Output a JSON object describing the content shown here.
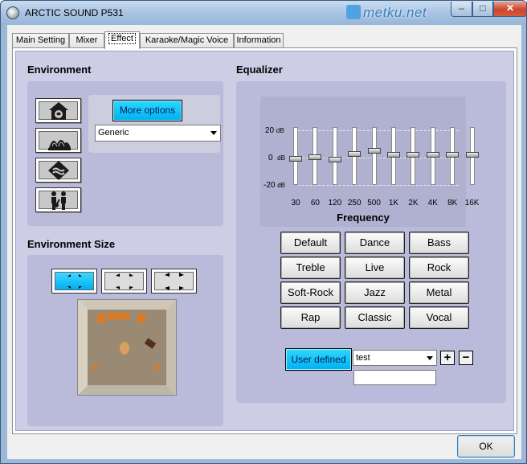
{
  "window": {
    "title": "ARCTIC SOUND P531",
    "watermark": "metku.net",
    "close_glyph": "✕",
    "min_glyph": "–",
    "max_glyph": "□"
  },
  "tabs": [
    {
      "label": "Main Setting"
    },
    {
      "label": "Mixer"
    },
    {
      "label": "Effect",
      "active": true
    },
    {
      "label": "Karaoke/Magic Voice"
    },
    {
      "label": "Information"
    }
  ],
  "environment": {
    "heading": "Environment",
    "buttons": [
      {
        "icon": "house-icon"
      },
      {
        "icon": "opera-house-icon"
      },
      {
        "icon": "water-icon"
      },
      {
        "icon": "people-icon"
      }
    ],
    "more_options_label": "More options",
    "preset": {
      "value": "Generic"
    }
  },
  "environment_size": {
    "heading": "Environment Size",
    "sizes": [
      {
        "icon": "small-room-icon",
        "active": true
      },
      {
        "icon": "medium-room-icon"
      },
      {
        "icon": "large-room-icon"
      }
    ]
  },
  "equalizer": {
    "heading": "Equalizer",
    "db_labels": [
      {
        "value": "20",
        "unit": "dB"
      },
      {
        "value": "0",
        "unit": "dB"
      },
      {
        "value": "-20",
        "unit": "dB"
      }
    ],
    "frequency_title": "Frequency",
    "bands": [
      {
        "label": "30",
        "level": 0.08
      },
      {
        "label": "60",
        "level": 0.03
      },
      {
        "label": "120",
        "level": 0.1
      },
      {
        "label": "250",
        "level": -0.08
      },
      {
        "label": "500",
        "level": -0.2
      },
      {
        "label": "1K",
        "level": -0.05
      },
      {
        "label": "2K",
        "level": -0.05
      },
      {
        "label": "4K",
        "level": -0.05
      },
      {
        "label": "8K",
        "level": -0.05
      },
      {
        "label": "16K",
        "level": -0.05
      }
    ],
    "presets": [
      "Default",
      "Dance",
      "Bass",
      "Treble",
      "Live",
      "Rock",
      "Soft-Rock",
      "Jazz",
      "Metal",
      "Rap",
      "Classic",
      "Vocal"
    ],
    "user_defined": {
      "button_label": "User defined",
      "selected": "test",
      "name_input": "",
      "add": "+",
      "remove": "−"
    }
  },
  "footer": {
    "ok_label": "OK"
  },
  "colors": {
    "accent_cyan": "#00b0f0",
    "panel_bg": "#cdcde5"
  }
}
